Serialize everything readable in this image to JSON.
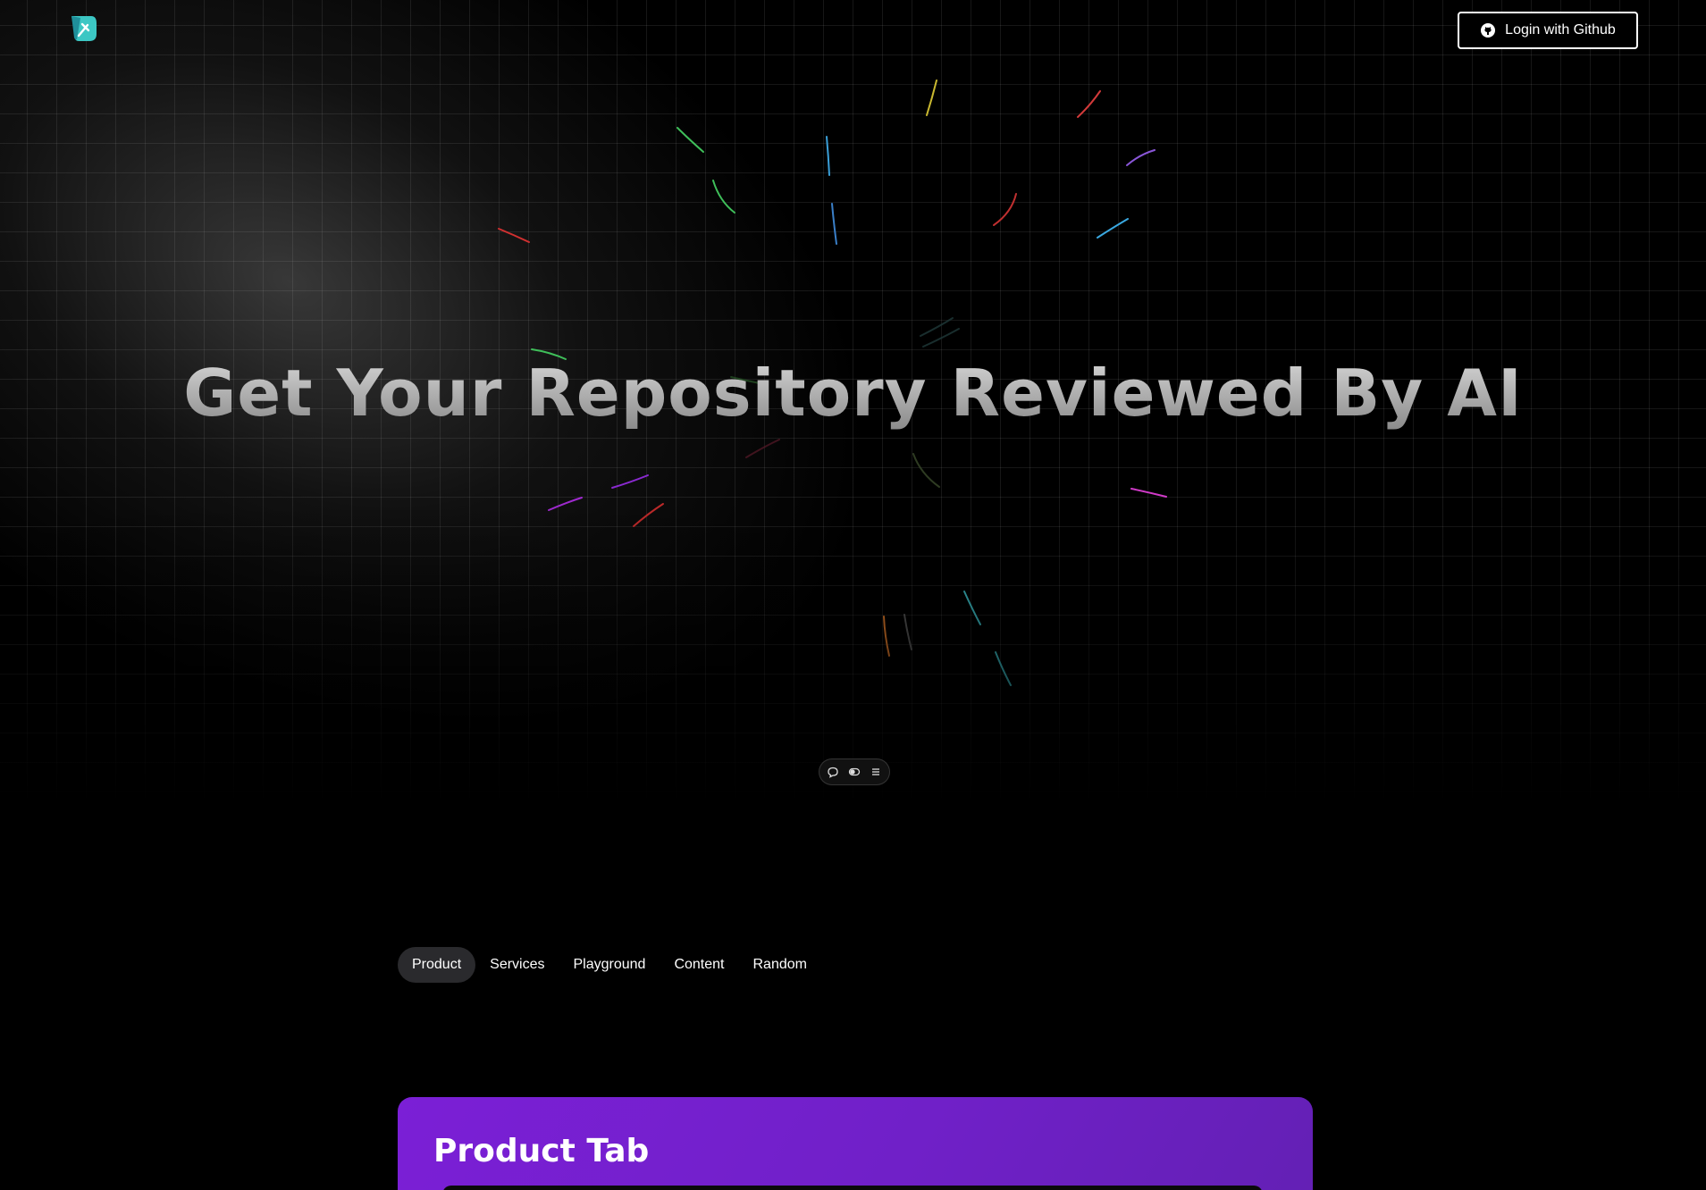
{
  "header": {
    "logo_name": "brand-logo",
    "login_button_label": "Login with Github",
    "login_icon": "github-icon"
  },
  "hero": {
    "headline": "Get Your Repository Reviewed By AI",
    "toolbar_icons": [
      "chat-bubble-icon",
      "toggle-icon",
      "menu-icon"
    ]
  },
  "tabs": [
    {
      "label": "Product",
      "active": true
    },
    {
      "label": "Services",
      "active": false
    },
    {
      "label": "Playground",
      "active": false
    },
    {
      "label": "Content",
      "active": false
    },
    {
      "label": "Random",
      "active": false
    }
  ],
  "card": {
    "title": "Product Tab"
  },
  "colors": {
    "background": "#000000",
    "card_gradient_start": "#7b1fd6",
    "card_gradient_end": "#6320b4",
    "active_tab_bg": "#2a2a2d",
    "logo_teal": "#3cc7c4"
  }
}
